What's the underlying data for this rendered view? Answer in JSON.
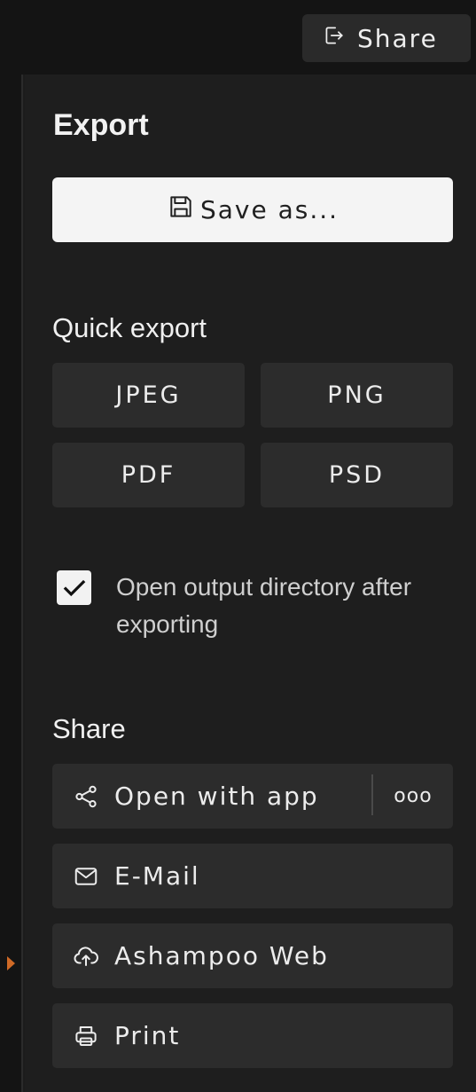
{
  "header": {
    "share_label": "Share",
    "share_icon": "share-export-icon"
  },
  "export": {
    "title": "Export",
    "save_as_label": "Save as...",
    "save_icon": "floppy-disk-icon"
  },
  "quick_export": {
    "title": "Quick export",
    "formats": [
      "JPEG",
      "PNG",
      "PDF",
      "PSD"
    ]
  },
  "options": {
    "open_dir_label": "Open output directory after exporting",
    "open_dir_checked": true
  },
  "share": {
    "title": "Share",
    "open_with_app": "Open with app",
    "more_label": "ooo",
    "email": "E-Mail",
    "web": "Ashampoo Web",
    "print": "Print"
  },
  "colors": {
    "background": "#1e1e1e",
    "button": "#2c2c2c",
    "primary_button": "#f4f4f4",
    "accent_marker": "#d06a26"
  }
}
